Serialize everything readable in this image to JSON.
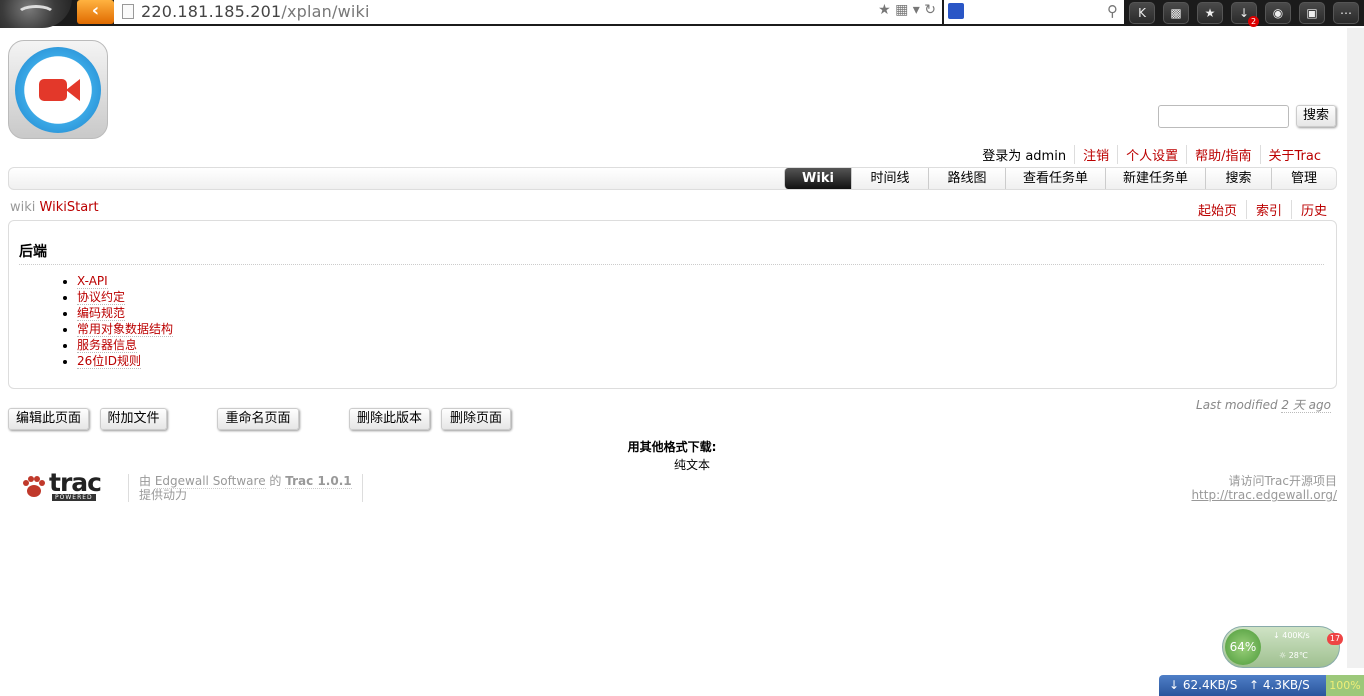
{
  "browser": {
    "url_host": "220.181.185.201",
    "url_path": "/xplan/wiki",
    "download_badge": "2"
  },
  "search": {
    "button_label": "搜索"
  },
  "metanav": {
    "logged_in": "登录为 admin",
    "items": [
      "注销",
      "个人设置",
      "帮助/指南",
      "关于Trac"
    ]
  },
  "mainnav": {
    "items": [
      "Wiki",
      "时间线",
      "路线图",
      "查看任务单",
      "新建任务单",
      "搜索",
      "管理"
    ]
  },
  "breadcrumb": {
    "parent": "wiki",
    "current": "WikiStart"
  },
  "ctxtnav": {
    "items": [
      "起始页",
      "索引",
      "历史"
    ]
  },
  "wiki": {
    "heading": "后端",
    "links": [
      "X-API",
      "协议约定",
      "编码规范",
      "常用对象数据结构",
      "服务器信息",
      "26位ID规则"
    ]
  },
  "last_modified": {
    "label": "Last modified",
    "ago": "2 天 ago"
  },
  "actions": {
    "edit": "编辑此页面",
    "attach": "附加文件",
    "rename": "重命名页面",
    "delete_version": "删除此版本",
    "delete_page": "删除页面"
  },
  "altlinks": {
    "header": "用其他格式下载:",
    "format": "纯文本"
  },
  "footer": {
    "powered": "POWERED",
    "trac_word": "trac",
    "by": "由",
    "edgewall": "Edgewall Software",
    "of": "的",
    "trac_version": "Trac 1.0.1",
    "provided": "提供动力",
    "visit": "请访问Trac开源项目",
    "url": "http://trac.edgewall.org/"
  },
  "desktop_widget": {
    "cpu_pct": "64%",
    "speed": "400K/s",
    "temp": "28℃",
    "notes": "17",
    "down": "62.4KB/S",
    "up": "4.3KB/S",
    "level": "100%"
  },
  "colors": {
    "link": "#bb0000",
    "active_tab": "#222222",
    "back_button": "#f08a10"
  }
}
